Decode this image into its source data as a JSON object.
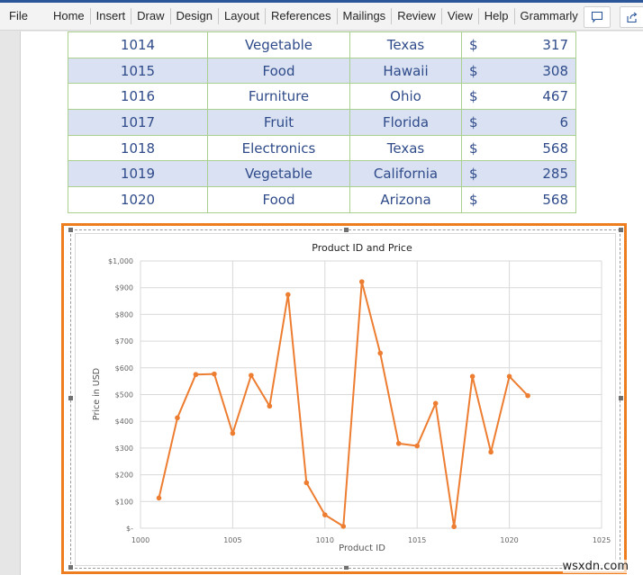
{
  "ribbon": {
    "tabs": [
      "File",
      "Home",
      "Insert",
      "Draw",
      "Design",
      "Layout",
      "References",
      "Mailings",
      "Review",
      "View",
      "Help",
      "Grammarly"
    ],
    "icons": [
      "comment-icon",
      "share-icon"
    ]
  },
  "table": {
    "rows": [
      {
        "id": "1014",
        "category": "Vegetable",
        "state": "Texas",
        "currency": "$",
        "price": "317"
      },
      {
        "id": "1015",
        "category": "Food",
        "state": "Hawaii",
        "currency": "$",
        "price": "308"
      },
      {
        "id": "1016",
        "category": "Furniture",
        "state": "Ohio",
        "currency": "$",
        "price": "467"
      },
      {
        "id": "1017",
        "category": "Fruit",
        "state": "Florida",
        "currency": "$",
        "price": "6"
      },
      {
        "id": "1018",
        "category": "Electronics",
        "state": "Texas",
        "currency": "$",
        "price": "568"
      },
      {
        "id": "1019",
        "category": "Vegetable",
        "state": "California",
        "currency": "$",
        "price": "285"
      },
      {
        "id": "1020",
        "category": "Food",
        "state": "Arizona",
        "currency": "$",
        "price": "568"
      }
    ]
  },
  "chart_data": {
    "type": "scatter",
    "title": "Product ID and Price",
    "xlabel": "Product ID",
    "ylabel": "Price in USD",
    "xlim": [
      1000,
      1025
    ],
    "ylim": [
      0,
      1000
    ],
    "xticks": [
      1000,
      1005,
      1010,
      1015,
      1020,
      1025
    ],
    "xtick_labels": [
      "1000",
      "1005",
      "1010",
      "1015",
      "1020",
      "1025"
    ],
    "yticks": [
      0,
      100,
      200,
      300,
      400,
      500,
      600,
      700,
      800,
      900,
      1000
    ],
    "ytick_labels": [
      "$-",
      "$100",
      "$200",
      "$300",
      "$400",
      "$500",
      "$600",
      "$700",
      "$800",
      "$900",
      "$1,000"
    ],
    "grid": true,
    "legend": "none",
    "series": [
      {
        "name": "Price",
        "color": "#ed7d31",
        "x": [
          1001,
          1002,
          1003,
          1004,
          1005,
          1006,
          1007,
          1008,
          1009,
          1010,
          1011,
          1012,
          1013,
          1014,
          1015,
          1016,
          1017,
          1018,
          1019,
          1020,
          1021
        ],
        "y": [
          113,
          413,
          575,
          577,
          355,
          572,
          457,
          874,
          170,
          50,
          7,
          922,
          655,
          317,
          308,
          467,
          6,
          568,
          285,
          568,
          496
        ]
      }
    ]
  },
  "watermark": "wsxdn.com"
}
